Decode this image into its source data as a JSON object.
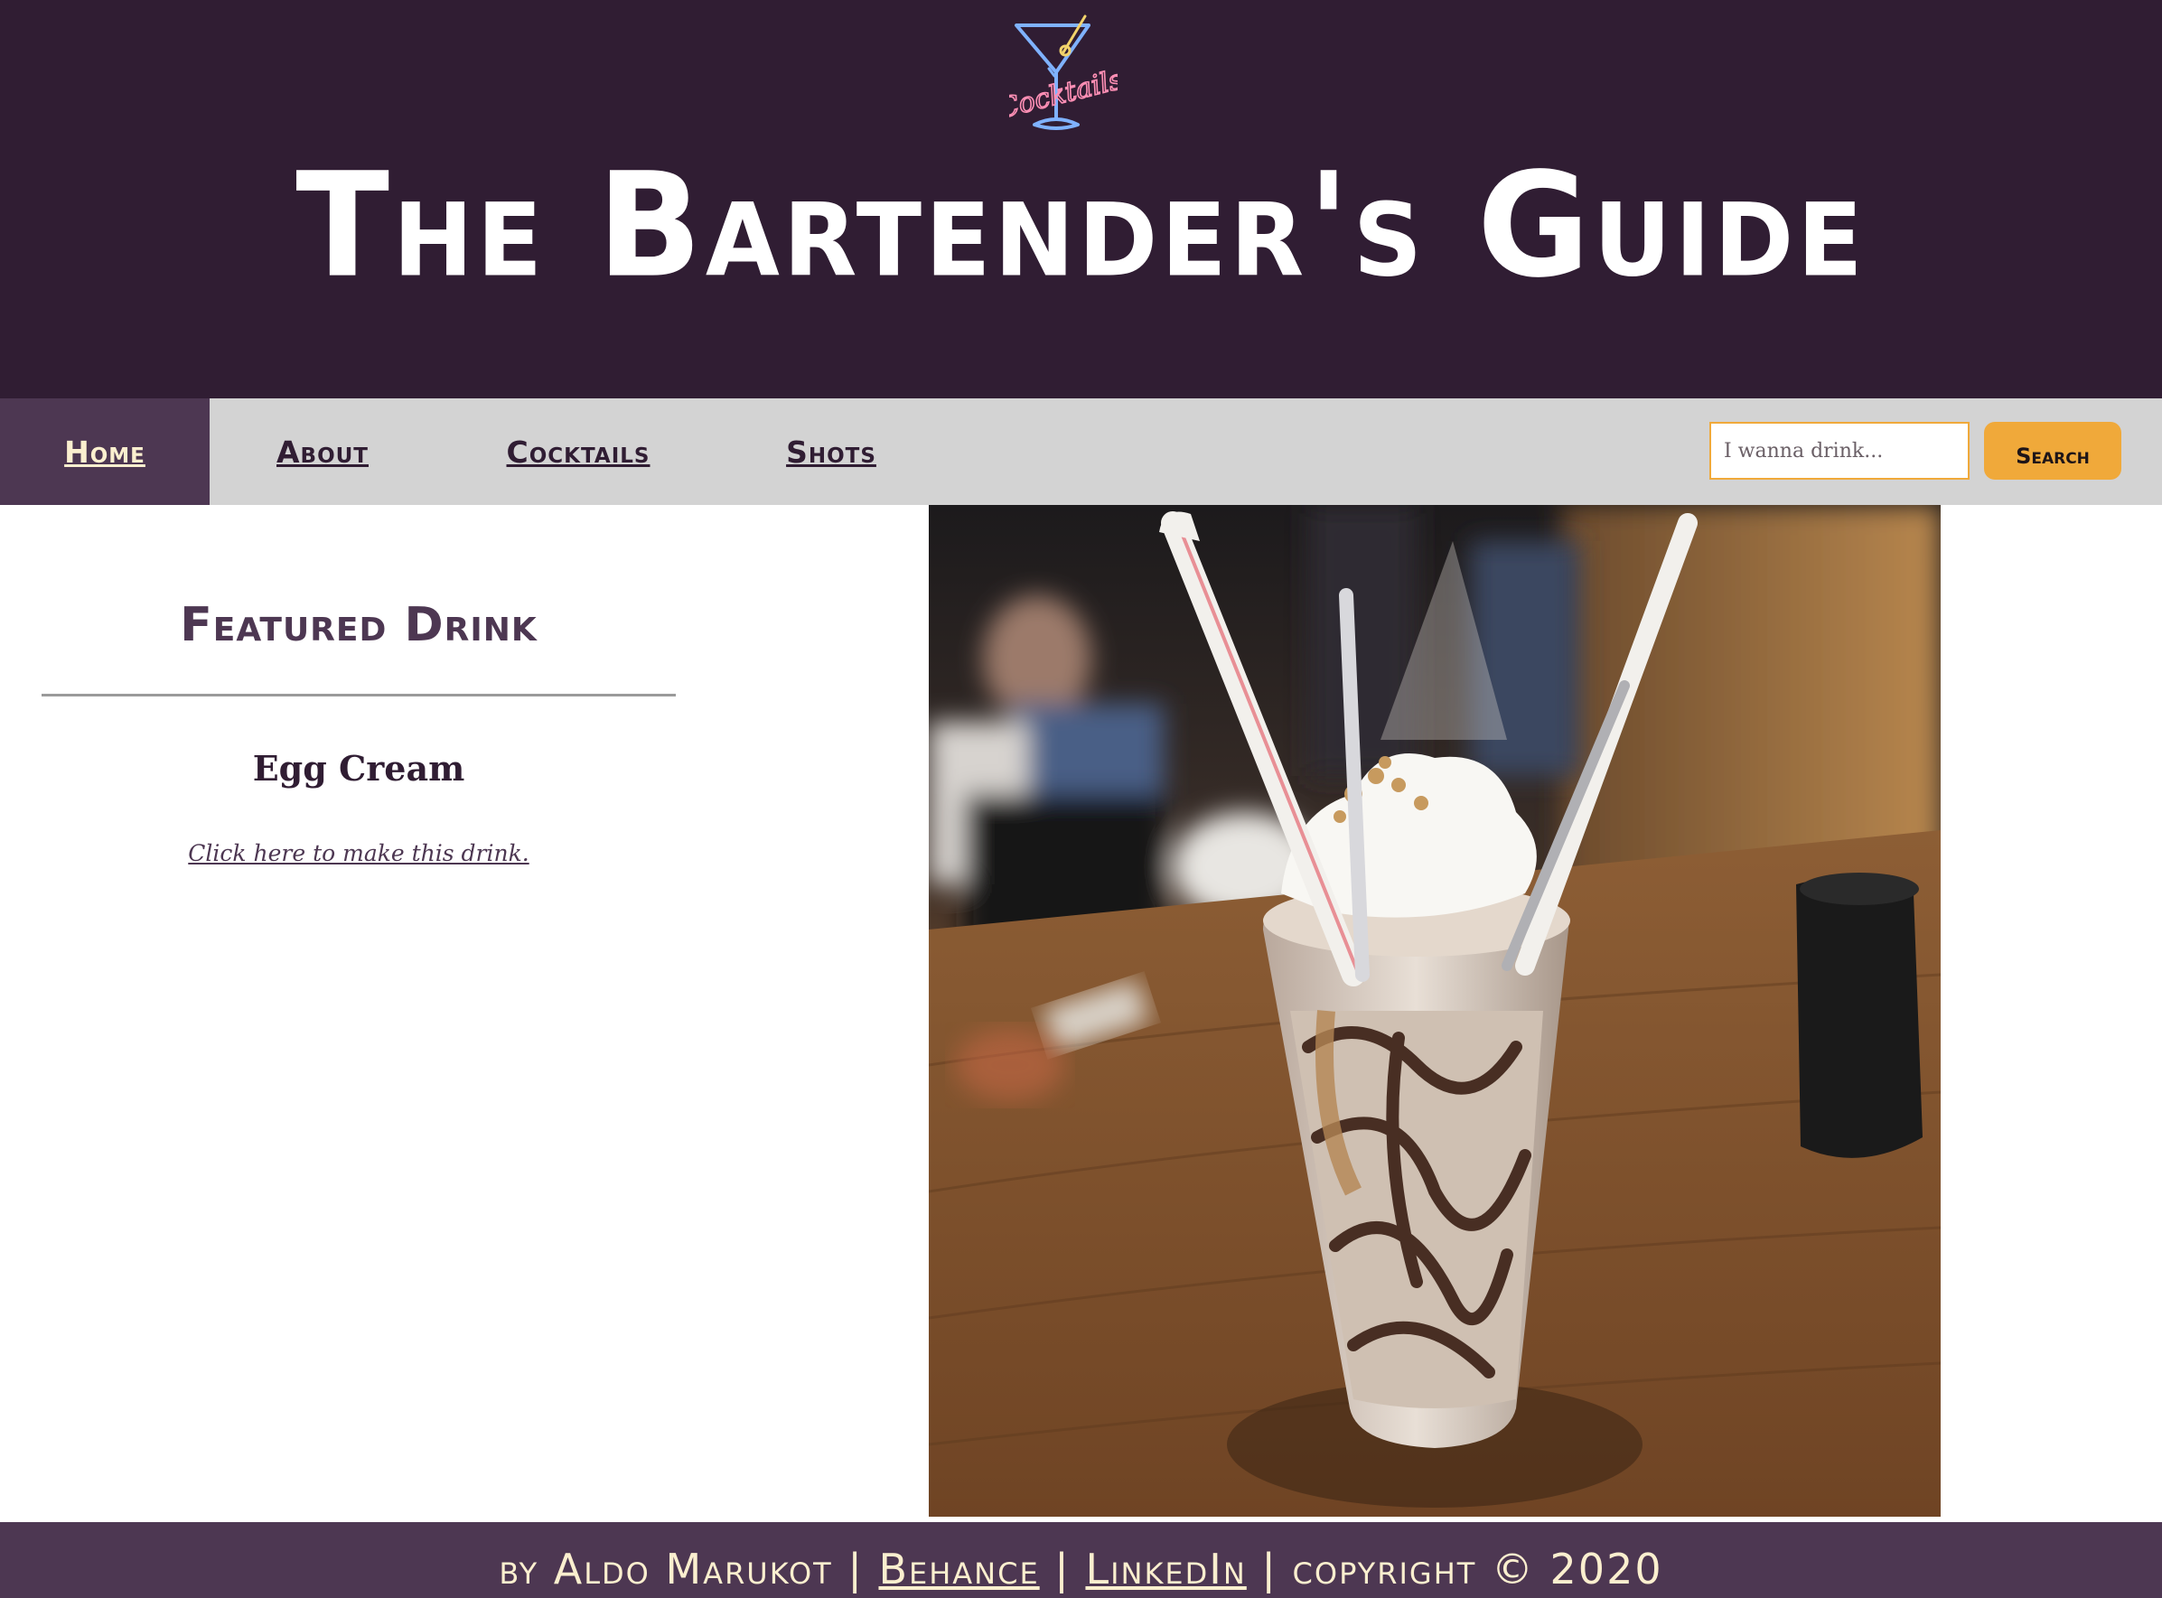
{
  "header": {
    "logo_text": "Cocktails",
    "title": "The Bartender's Guide"
  },
  "nav": {
    "items": [
      {
        "label": "Home",
        "active": true
      },
      {
        "label": "About",
        "active": false
      },
      {
        "label": "Cocktails",
        "active": false
      },
      {
        "label": "Shots",
        "active": false
      }
    ],
    "search": {
      "placeholder": "I wanna drink...",
      "button_label": "Search"
    }
  },
  "featured": {
    "heading": "Featured Drink",
    "drink_name": "Egg Cream",
    "link_text": "Click here to make this drink."
  },
  "footer": {
    "by": "by Aldo Marukot",
    "sep": " | ",
    "behance": "Behance",
    "linkedin": "LinkedIn",
    "copyright": "copyright © 2020"
  },
  "colors": {
    "header_bg": "#301d33",
    "accent": "#4d3752",
    "cream": "#fbefcf",
    "search_orange": "#f0a93a",
    "nav_bg": "#d3d3d3"
  }
}
